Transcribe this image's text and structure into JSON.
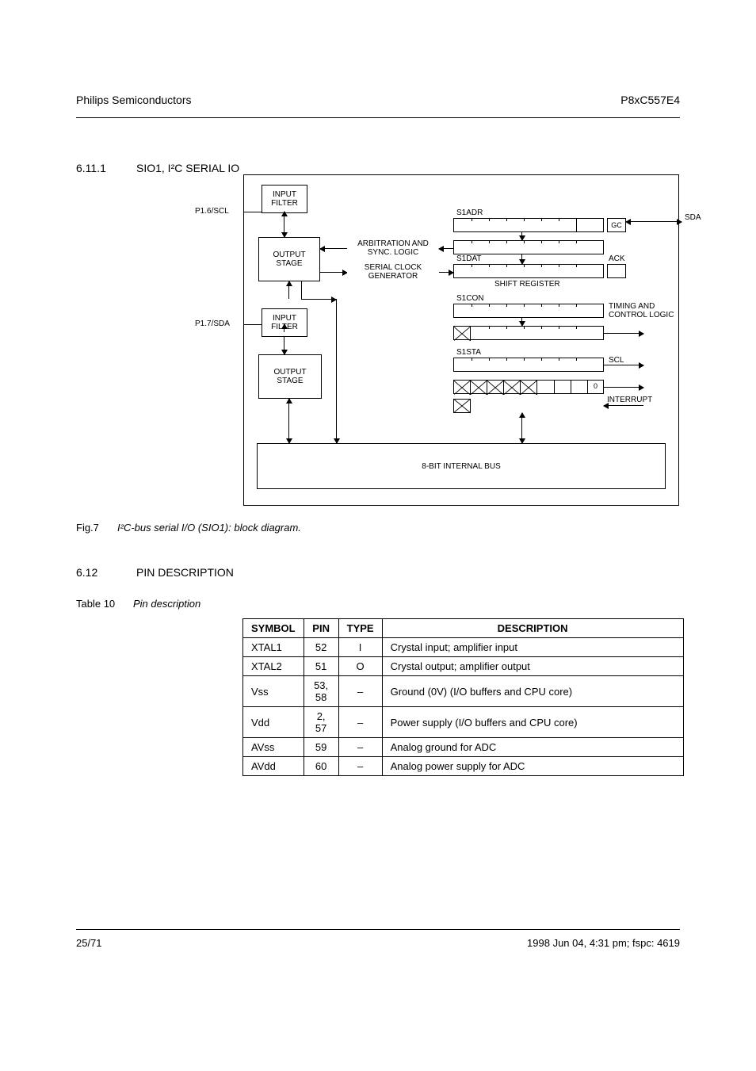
{
  "header": {
    "left": "Philips Semiconductors",
    "right": "P8xC557E4"
  },
  "section": {
    "num": "6.11.1",
    "title": "SIO1, I²C SERIAL IO"
  },
  "figure": {
    "caption_num": "Fig.7",
    "caption_title": "I²C-bus serial I/O (SIO1): block diagram.",
    "blocks": {
      "input_filter_1": "INPUT\nFILTER",
      "output_stage_1": "OUTPUT\nSTAGE",
      "input_filter_2": "INPUT\nFILTER",
      "output_stage_2": "OUTPUT\nSTAGE",
      "bus": "8-BIT INTERNAL BUS"
    },
    "side_labels": {
      "scl": "P1.6/SCL",
      "sda": "P1.7/SDA",
      "scl_out": "SCL",
      "sda_out": "SDA"
    },
    "arrow_labels": {
      "arb": "ARBITRATION AND\nSYNC. LOGIC",
      "gen": "SERIAL CLOCK\nGENERATOR",
      "ack": "ACK",
      "timing": "TIMING AND\nCONTROL LOGIC",
      "intr": "INTERRUPT"
    },
    "registers": {
      "s1adr": "S1ADR",
      "s1adr_bit": "GC",
      "s1dat": "S1DAT",
      "shift": "SHIFT REGISTER",
      "s1con": "S1CON",
      "s1sta": "S1STA",
      "s1sta_bit": "0"
    }
  },
  "pins": {
    "section_num": "6.12",
    "section_title": "PIN DESCRIPTION",
    "caption_num": "Table 10",
    "caption_title": "Pin description",
    "headers": [
      "SYMBOL",
      "PIN",
      "TYPE",
      "DESCRIPTION"
    ],
    "rows": [
      [
        "XTAL1",
        "52",
        "I",
        "Crystal input; amplifier input"
      ],
      [
        "XTAL2",
        "51",
        "O",
        "Crystal output; amplifier output"
      ],
      [
        "Vss",
        "53, 58",
        "–",
        "Ground (0V) (I/O buffers and CPU core)"
      ],
      [
        "Vdd",
        "2, 57",
        "–",
        "Power supply (I/O buffers and CPU core)"
      ],
      [
        "AVss",
        "59",
        "–",
        "Analog ground for ADC"
      ],
      [
        "AVdd",
        "60",
        "–",
        "Analog power supply for ADC"
      ]
    ]
  },
  "footer": {
    "left": "25/71",
    "right": "1998 Jun 04, 4:31 pm; fspc: 4619"
  }
}
